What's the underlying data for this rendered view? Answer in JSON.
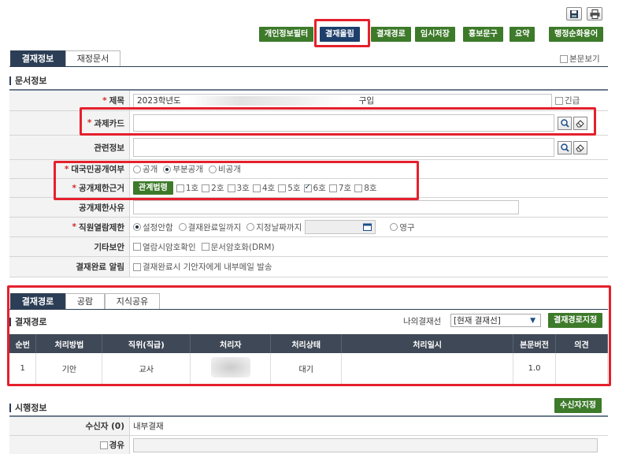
{
  "toolbar": {
    "buttons": [
      "개인정보필터",
      "결재올림",
      "결재경로",
      "임시저장",
      "홍보문구",
      "요약",
      "행정순화용어"
    ]
  },
  "top_tabs": [
    "결재정보",
    "재정문서"
  ],
  "show_body": "본문보기",
  "doc_section_title": "문서정보",
  "fields": {
    "title_label": "제목",
    "title_value_prefix": "2023학년도",
    "title_value_suffix": "구입",
    "urgent_label": "긴급",
    "task_card_label": "과제카드",
    "related_label": "관련정보",
    "public_label": "대국민공개여부",
    "public_options": [
      "공개",
      "부분공개",
      "비공개"
    ],
    "restrict_label": "공개제한근거",
    "law_button": "관계법령",
    "restrict_options": [
      "1호",
      "2호",
      "3호",
      "4호",
      "5호",
      "6호",
      "7호",
      "8호"
    ],
    "restrict_reason_label": "공개제한사유",
    "staff_label": "직원열람제한",
    "staff_options": [
      "설정안함",
      "결재완료일까지",
      "지정날짜까지",
      "영구"
    ],
    "security_label": "기타보안",
    "security_options": [
      "열람시암호확인",
      "문서암호화(DRM)"
    ],
    "notify_label": "결재완료 알림",
    "notify_option": "결재완료시 기안자에게 내부메일 발송"
  },
  "route_tabs": [
    "결재경로",
    "공람",
    "지식공유"
  ],
  "route_title": "결재경로",
  "my_route_label": "나의결재선",
  "my_route_value": "[현재 결재선]",
  "route_assign_button": "결재경로지정",
  "grid_headers": [
    "순번",
    "처리방법",
    "직위(직급)",
    "처리자",
    "처리상태",
    "처리일시",
    "본문버전",
    "의견"
  ],
  "grid_rows": [
    {
      "no": "1",
      "method": "기안",
      "position": "교사",
      "handler": "",
      "status": "대기",
      "datetime": "",
      "version": "1.0",
      "opinion": ""
    }
  ],
  "exec_title": "시행정보",
  "receiver_button": "수신자지정",
  "receiver_label": "수신자 (0)",
  "receiver_value": "내부결재",
  "via_label": "경유"
}
